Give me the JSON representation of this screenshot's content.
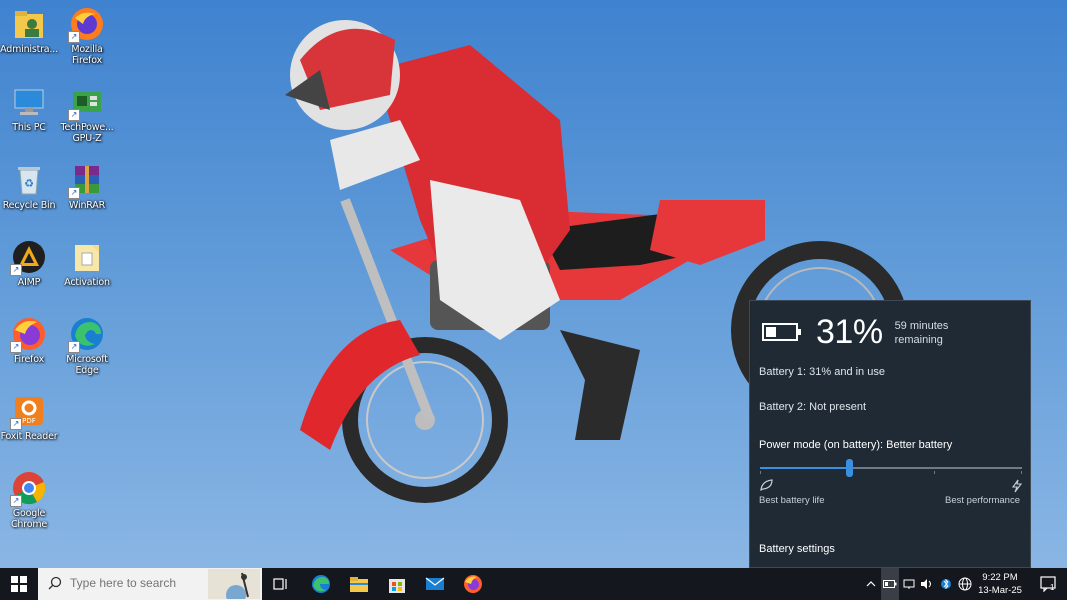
{
  "desktop_icons": [
    {
      "label": "Administra..."
    },
    {
      "label": "Mozilla Firefox"
    },
    {
      "label": "This PC"
    },
    {
      "label": "TechPowe... GPU-Z"
    },
    {
      "label": "Recycle Bin"
    },
    {
      "label": "WinRAR"
    },
    {
      "label": "AIMP"
    },
    {
      "label": "Activation"
    },
    {
      "label": "Firefox"
    },
    {
      "label": "Microsoft Edge"
    },
    {
      "label": "Foxit Reader"
    },
    {
      "label": "Google Chrome"
    }
  ],
  "battery_flyout": {
    "percent": "31%",
    "time_remaining": "59 minutes remaining",
    "battery1": "Battery 1: 31% and in use",
    "battery2": "Battery 2: Not present",
    "power_mode": "Power mode (on battery): Better battery",
    "slider_level": 0.34,
    "left_label": "Best battery life",
    "right_label": "Best performance",
    "settings_link": "Battery settings"
  },
  "taskbar": {
    "search_placeholder": "Type here to search",
    "clock_time": "9:22 PM",
    "clock_date": "13-Mar-25",
    "notification_count": "1"
  },
  "colors": {
    "accent": "#3b8fe0",
    "flyout_bg": "#1f2a35",
    "taskbar_bg": "#14171d"
  }
}
